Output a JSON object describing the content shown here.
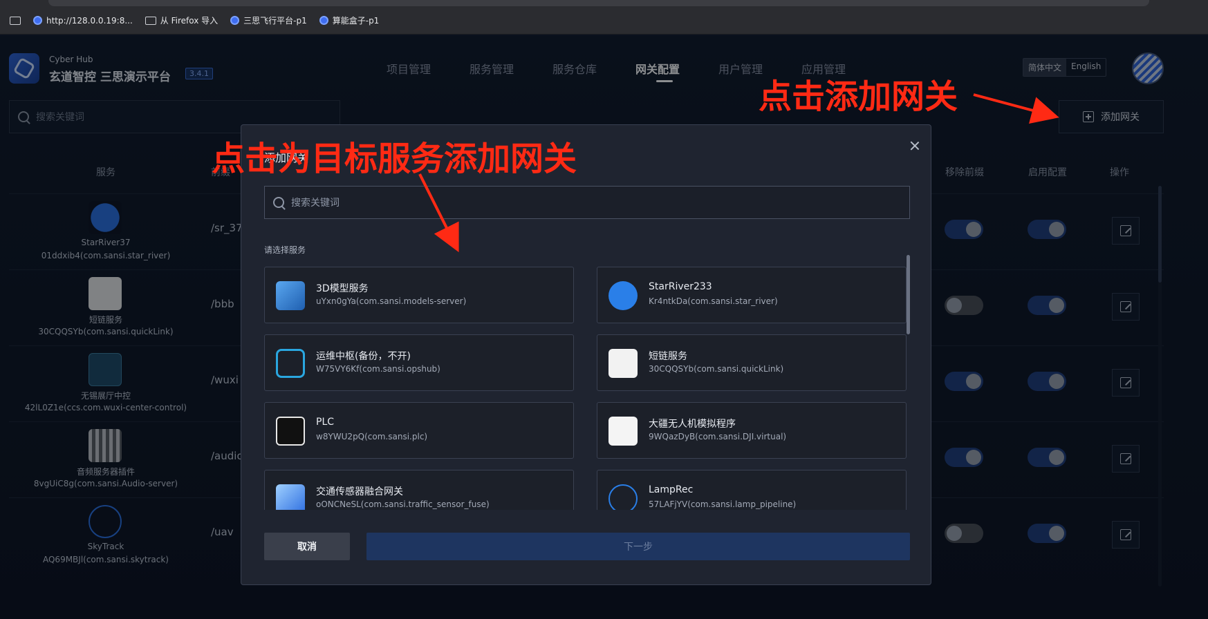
{
  "bookmarks": [
    {
      "label": "",
      "icon": "folder-icon"
    },
    {
      "label": "http://128.0.0.19:8...",
      "icon": "globe-icon"
    },
    {
      "label": "从 Firefox 导入",
      "icon": "folder-icon"
    },
    {
      "label": "三思飞行平台-p1",
      "icon": "globe-icon"
    },
    {
      "label": "算能盒子-p1",
      "icon": "globe-icon"
    }
  ],
  "header": {
    "brand_sub": "Cyber Hub",
    "brand_title": "玄道智控 三思演示平台",
    "version": "3.4.1",
    "nav": [
      "项目管理",
      "服务管理",
      "服务仓库",
      "网关配置",
      "用户管理",
      "应用管理"
    ],
    "active_nav": "网关配置",
    "lang": [
      "简体中文",
      "English"
    ]
  },
  "toolbar": {
    "search_placeholder": "搜索关键词",
    "add_gateway_label": "添加网关"
  },
  "table": {
    "headers": [
      "服务",
      "前缀",
      "移除前缀",
      "启用配置",
      "操作"
    ],
    "rows": [
      {
        "name": "StarRiver37",
        "id": "01ddxib4(com.sansi.star_river)",
        "prefix": "/sr_37",
        "remove_prefix": true,
        "enabled": true,
        "icon": "star-river-icon"
      },
      {
        "name": "短链服务",
        "id": "30CQQSYb(com.sansi.quickLink)",
        "prefix": "/bbb",
        "remove_prefix": false,
        "enabled": true,
        "icon": "quicklink-icon"
      },
      {
        "name": "无锡展厅中控",
        "id": "42lL0Z1e(ccs.com.wuxi-center-control)",
        "prefix": "/wuxi",
        "remove_prefix": true,
        "enabled": true,
        "icon": "cubes-icon"
      },
      {
        "name": "音频服务器插件",
        "id": "8vgUiC8g(com.sansi.Audio-server)",
        "prefix": "/audio",
        "remove_prefix": true,
        "enabled": true,
        "icon": "mixer-icon"
      },
      {
        "name": "SkyTrack",
        "id": "AQ69MBJl(com.sansi.skytrack)",
        "prefix": "/uav",
        "remove_prefix": false,
        "enabled": true,
        "icon": "network-icon"
      }
    ]
  },
  "modal": {
    "title": "添加网关",
    "search_placeholder": "搜索关键词",
    "choose_label": "请选择服务",
    "cards": [
      {
        "title": "3D模型服务",
        "subtitle": "uYxn0gYa(com.sansi.models-server)",
        "icon": "cube-icon"
      },
      {
        "title": "StarRiver233",
        "subtitle": "Kr4ntkDa(com.sansi.star_river)",
        "icon": "star-river-icon"
      },
      {
        "title": "运维中枢(备份，不开)",
        "subtitle": "W75VY6Kf(com.sansi.opshub)",
        "icon": "ops-hub-icon"
      },
      {
        "title": "短链服务",
        "subtitle": "30CQQSYb(com.sansi.quickLink)",
        "icon": "quicklink-icon"
      },
      {
        "title": "PLC",
        "subtitle": "w8YWU2pQ(com.sansi.plc)",
        "icon": "plc-icon"
      },
      {
        "title": "大疆无人机模拟程序",
        "subtitle": "9WQazDyB(com.sansi.DJI.virtual)",
        "icon": "dji-icon"
      },
      {
        "title": "交通传感器融合网关",
        "subtitle": "oONCNeSL(com.sansi.traffic_sensor_fuse)",
        "icon": "traffic-icon"
      },
      {
        "title": "LampRec",
        "subtitle": "57LAFjYV(com.sansi.lamp_pipeline)",
        "icon": "network-icon"
      }
    ],
    "cancel_label": "取消",
    "next_label": "下一步"
  },
  "annotations": {
    "add_gateway": "点击添加网关",
    "add_for_service": "点击为目标服务添加网关",
    "color": "#ff2a14"
  }
}
